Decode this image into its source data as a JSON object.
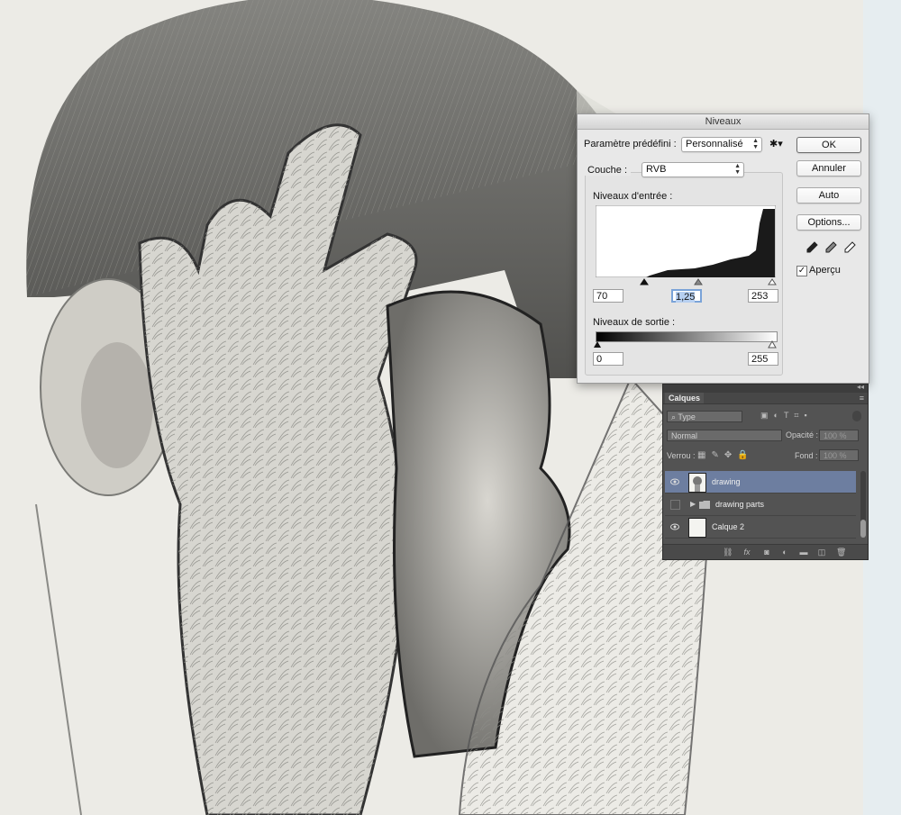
{
  "levels": {
    "title": "Niveaux",
    "preset_label": "Paramètre prédéfini :",
    "preset_value": "Personnalisé",
    "channel_label": "Couche :",
    "channel_value": "RVB",
    "input_levels_label": "Niveaux d'entrée :",
    "input_black": "70",
    "input_gamma": "1,25",
    "input_white": "253",
    "output_levels_label": "Niveaux de sortie :",
    "output_black": "0",
    "output_white": "255",
    "ok": "OK",
    "cancel": "Annuler",
    "auto": "Auto",
    "options": "Options...",
    "preview_label": "Aperçu",
    "preview_checked": true
  },
  "layers": {
    "tab": "Calques",
    "filter_kind": "Type",
    "blend_mode": "Normal",
    "opacity_label": "Opacité :",
    "opacity_value": "100 %",
    "lock_label": "Verrou :",
    "fill_label": "Fond :",
    "fill_value": "100 %",
    "items": [
      {
        "name": "drawing",
        "active": true,
        "visible": true,
        "type": "layer"
      },
      {
        "name": "drawing parts",
        "active": false,
        "visible": false,
        "type": "group"
      },
      {
        "name": "Calque 2",
        "active": false,
        "visible": true,
        "type": "layer"
      }
    ]
  },
  "icons": [
    "gear-icon",
    "black-eyedropper-icon",
    "gray-eyedropper-icon",
    "white-eyedropper-icon",
    "eye-icon",
    "folder-icon",
    "link-icon",
    "fx-icon",
    "mask-icon",
    "adjustment-icon",
    "group-icon",
    "new-layer-icon",
    "trash-icon"
  ]
}
